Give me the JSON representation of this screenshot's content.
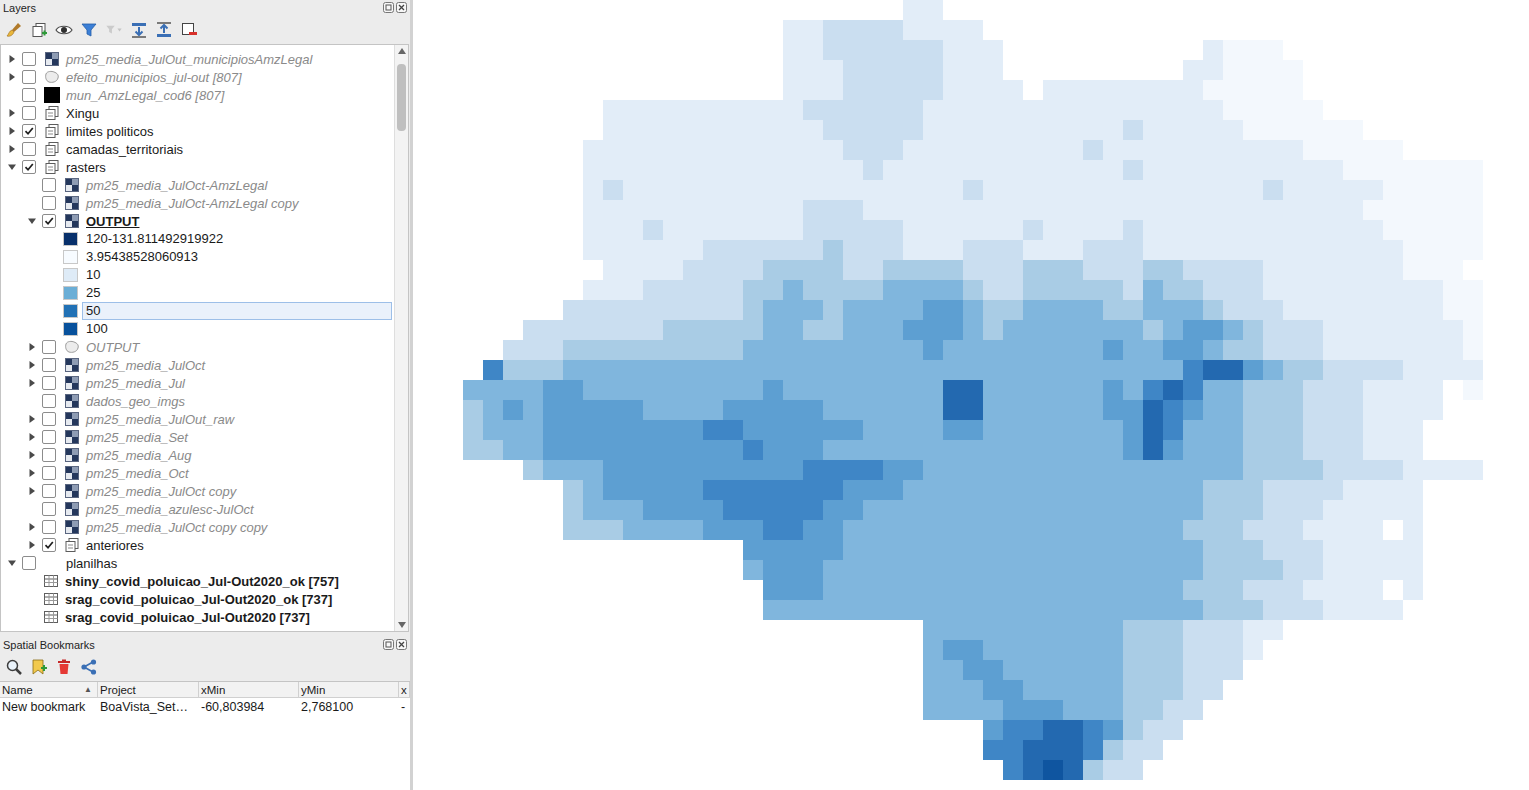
{
  "layers": {
    "title": "Layers",
    "toolbar": [
      {
        "kind": "style",
        "disabled": false
      },
      {
        "kind": "add-group",
        "disabled": false
      },
      {
        "kind": "themes",
        "disabled": false
      },
      {
        "kind": "filter",
        "disabled": false
      },
      {
        "kind": "expression-filter",
        "disabled": true
      },
      {
        "kind": "expand-all",
        "disabled": false
      },
      {
        "kind": "collapse-all",
        "disabled": false
      },
      {
        "kind": "remove",
        "disabled": false
      }
    ],
    "tree": [
      {
        "label": "pm25_media_JulOut_municipiosAmzLegal",
        "kind": "raster",
        "depth": 0,
        "expanded": false,
        "checked": false,
        "greyed": true,
        "bold": false,
        "current": false,
        "selected": false
      },
      {
        "label": "efeito_municipios_jul-out [807]",
        "kind": "polygon",
        "depth": 0,
        "expanded": false,
        "checked": false,
        "greyed": true,
        "bold": false,
        "current": false,
        "selected": false
      },
      {
        "label": "mun_AmzLegal_cod6 [807]",
        "kind": "fill",
        "depth": 0,
        "checked": false,
        "greyed": true,
        "bold": false,
        "current": false,
        "selected": false
      },
      {
        "label": "Xingu",
        "kind": "group",
        "depth": 0,
        "expanded": false,
        "checked": false,
        "greyed": false,
        "bold": false,
        "current": false,
        "selected": false
      },
      {
        "label": "limites politicos",
        "kind": "group",
        "depth": 0,
        "expanded": false,
        "checked": true,
        "greyed": false,
        "bold": false,
        "current": false,
        "selected": false
      },
      {
        "label": "camadas_territoriais",
        "kind": "group",
        "depth": 0,
        "expanded": false,
        "checked": false,
        "greyed": false,
        "bold": false,
        "current": false,
        "selected": false
      },
      {
        "label": "rasters",
        "kind": "group",
        "depth": 0,
        "expanded": true,
        "checked": true,
        "greyed": false,
        "bold": false,
        "current": false,
        "selected": false
      },
      {
        "label": "pm25_media_JulOct-AmzLegal",
        "kind": "raster",
        "depth": 1,
        "checked": false,
        "greyed": true,
        "bold": false,
        "current": false,
        "selected": false
      },
      {
        "label": "pm25_media_JulOct-AmzLegal copy",
        "kind": "raster",
        "depth": 1,
        "checked": false,
        "greyed": true,
        "bold": false,
        "current": false,
        "selected": false
      },
      {
        "label": "OUTPUT",
        "kind": "raster",
        "depth": 1,
        "expanded": true,
        "checked": true,
        "greyed": false,
        "bold": true,
        "current": true,
        "selected": false
      },
      {
        "label": "120-131.811492919922",
        "kind": "legend",
        "depth": 2,
        "color": "#08306b",
        "selected": false
      },
      {
        "label": "3.95438528060913",
        "kind": "legend",
        "depth": 2,
        "color": "#f7fbff",
        "selected": false
      },
      {
        "label": "10",
        "kind": "legend",
        "depth": 2,
        "color": "#deebf7",
        "selected": false
      },
      {
        "label": "25",
        "kind": "legend",
        "depth": 2,
        "color": "#6baed6",
        "selected": false
      },
      {
        "label": "50",
        "kind": "legend",
        "depth": 2,
        "color": "#2171b5",
        "selected": true
      },
      {
        "label": "100",
        "kind": "legend",
        "depth": 2,
        "color": "#08519c",
        "selected": false
      },
      {
        "label": "OUTPUT",
        "kind": "polygon",
        "depth": 1,
        "expanded": false,
        "checked": false,
        "greyed": true,
        "bold": false,
        "current": false,
        "selected": false
      },
      {
        "label": "pm25_media_JulOct",
        "kind": "raster",
        "depth": 1,
        "expanded": false,
        "checked": false,
        "greyed": true,
        "bold": false,
        "current": false,
        "selected": false
      },
      {
        "label": "pm25_media_Jul",
        "kind": "raster",
        "depth": 1,
        "expanded": false,
        "checked": false,
        "greyed": true,
        "bold": false,
        "current": false,
        "selected": false
      },
      {
        "label": "dados_geo_imgs",
        "kind": "raster",
        "depth": 1,
        "checked": false,
        "greyed": true,
        "bold": false,
        "current": false,
        "selected": false
      },
      {
        "label": "pm25_media_JulOut_raw",
        "kind": "raster",
        "depth": 1,
        "expanded": false,
        "checked": false,
        "greyed": true,
        "bold": false,
        "current": false,
        "selected": false
      },
      {
        "label": "pm25_media_Set",
        "kind": "raster",
        "depth": 1,
        "expanded": false,
        "checked": false,
        "greyed": true,
        "bold": false,
        "current": false,
        "selected": false
      },
      {
        "label": "pm25_media_Aug",
        "kind": "raster",
        "depth": 1,
        "expanded": false,
        "checked": false,
        "greyed": true,
        "bold": false,
        "current": false,
        "selected": false
      },
      {
        "label": "pm25_media_Oct",
        "kind": "raster",
        "depth": 1,
        "expanded": false,
        "checked": false,
        "greyed": true,
        "bold": false,
        "current": false,
        "selected": false
      },
      {
        "label": "pm25_media_JulOct copy",
        "kind": "raster",
        "depth": 1,
        "expanded": false,
        "checked": false,
        "greyed": true,
        "bold": false,
        "current": false,
        "selected": false
      },
      {
        "label": "pm25_media_azulesc-JulOct",
        "kind": "raster",
        "depth": 1,
        "checked": false,
        "greyed": true,
        "bold": false,
        "current": false,
        "selected": false
      },
      {
        "label": "pm25_media_JulOct copy copy",
        "kind": "raster",
        "depth": 1,
        "expanded": false,
        "checked": false,
        "greyed": true,
        "bold": false,
        "current": false,
        "selected": false
      },
      {
        "label": "anteriores",
        "kind": "group",
        "depth": 1,
        "expanded": false,
        "checked": true,
        "greyed": false,
        "bold": false,
        "current": false,
        "selected": false
      },
      {
        "label": "planilhas",
        "kind": "folder",
        "depth": 0,
        "expanded": true,
        "checked": false,
        "greyed": false,
        "bold": false,
        "current": false,
        "selected": false
      },
      {
        "label": "shiny_covid_poluicao_Jul-Out2020_ok [757]",
        "kind": "table",
        "depth": 1,
        "greyed": false,
        "bold": true,
        "current": false,
        "selected": false
      },
      {
        "label": "srag_covid_poluicao_Jul-Out2020_ok [737]",
        "kind": "table",
        "depth": 1,
        "greyed": false,
        "bold": true,
        "current": false,
        "selected": false
      },
      {
        "label": "srag_covid_poluicao_Jul-Out2020 [737]",
        "kind": "table",
        "depth": 1,
        "greyed": false,
        "bold": true,
        "current": false,
        "selected": false
      }
    ],
    "scrollbar": {
      "offset": 0.012,
      "level": 0.12
    }
  },
  "bookmarks": {
    "title": "Spatial Bookmarks",
    "toolbar": [
      {
        "kind": "zoom",
        "disabled": false
      },
      {
        "kind": "add",
        "disabled": false
      },
      {
        "kind": "delete",
        "disabled": false
      },
      {
        "kind": "share",
        "disabled": false
      }
    ],
    "columns": [
      {
        "label": "Name",
        "sort": "▲"
      },
      {
        "label": "Project",
        "sort": ""
      },
      {
        "label": "xMin",
        "sort": ""
      },
      {
        "label": "yMin",
        "sort": ""
      },
      {
        "label": "x",
        "sort": ""
      }
    ],
    "rows": [
      {
        "cells": [
          "New bookmark",
          "BoaVista_Set…",
          "-60,803984",
          "2,768100",
          "-"
        ],
        "selected": false
      }
    ]
  },
  "map": {
    "palette": [
      "#f3f8fd",
      "#e2edf8",
      "#cadef0",
      "#a9cce5",
      "#80b6dd",
      "#5d9fd2",
      "#3f86c6",
      "#2369b0",
      "#0f55a0"
    ],
    "grid": [
      "......................11",
      "................1122221111",
      "................11222222111..........1000",
      "................11122222111.........110000",
      "................111222221111.1111111100000",
      ".......111111111122222211111111111111100000",
      ".......11111111111222221111111111211111000000",
      "......11111111111112221111111112111111111100000",
      "......111111111111112111111111111211111111110000000",
      "......121111111111111111121111111111111121111100000",
      "......111111111112221111111111111111111111111000000",
      "......111211111112222211111121111211111111111100000",
      "......111111222222322211122211122211111111111110000",
      ".......1111222233332233332223332223322221111111000",
      "......111222223343333444432233333243322211111111100",
      ".....2222222223444344445543344443344432221111111100",
      "...222222233333443344455543444444434554322211111110",
      "..2223333333334444444445444444445445543322211111110",
      ".63334444444444444444444444444444444677543322221111110",
      "4444554444444445444444447744444454676443332221111 0",
      "3454555554444555554444447744444455765443332221111",
      "344455555555665555554444554444444576444333222111",
      "334455555555556555444444444444444575444333222111",
      "...344455555555556666554444444444444444333322221111",
      ".....3455555666666655544444444444444433322221111",
      ".....3444555566666554444444444444444433322211111",
      ".....33344445556655444444444444444443332221111 1",
      "..............5555544444444444444444433322211111",
      "..............4555444444444444444444433332211111",
      "...............5554444444444444444443332221111 1",
      "...............44444444444444444444443332221111",
      ".......................444444444433322211",
      ".......................45544444443332221",
      ".......................4455444444333222",
      ".......................444554444433322",
      ".......................44445554443322",
      "..........................5667765322",
      "..........................667776322",
      "...........................6787322"
    ]
  }
}
